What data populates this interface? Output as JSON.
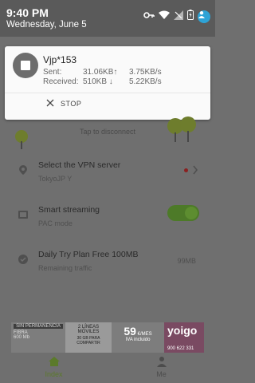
{
  "status": {
    "time": "9:40 PM",
    "date": "Wednesday, June 5"
  },
  "notification": {
    "title": "Vjp*153",
    "sent_label": "Sent:",
    "sent_total": "31.06KB↑",
    "sent_rate": "3.75KB/s",
    "received_label": "Received:",
    "received_total": "510KB ↓",
    "received_rate": "5.22KB/s",
    "action_label": "STOP"
  },
  "app": {
    "tap_hint": "Tap to disconnect",
    "server": {
      "title": "Select the VPN server",
      "subtitle": "TokyoJP Y"
    },
    "smart": {
      "title": "Smart streaming",
      "subtitle": "PAC mode",
      "enabled": true
    },
    "plan": {
      "title": "Daily Try  Plan Free 100MB",
      "subtitle": "Remaining traffic",
      "value": "99MB"
    }
  },
  "ad": {
    "line1": "SIN PERMANENCIA",
    "line2": "FIBRA",
    "line3": "600 Mb",
    "line4": "2 LÍNEAS",
    "line5": "MÓVILES",
    "line6": "30 GB PARA COMPARTIR",
    "price": "59",
    "price_unit": "€/MES",
    "price_note": "IVA incluido",
    "brand": "yoigo",
    "phone": "900 622 331"
  },
  "nav": {
    "index_label": "Index",
    "me_label": "Me"
  },
  "colors": {
    "accent": "#5b7a2a",
    "shade": "#5a5a5a",
    "dim_bg": "#6f6f6f"
  }
}
